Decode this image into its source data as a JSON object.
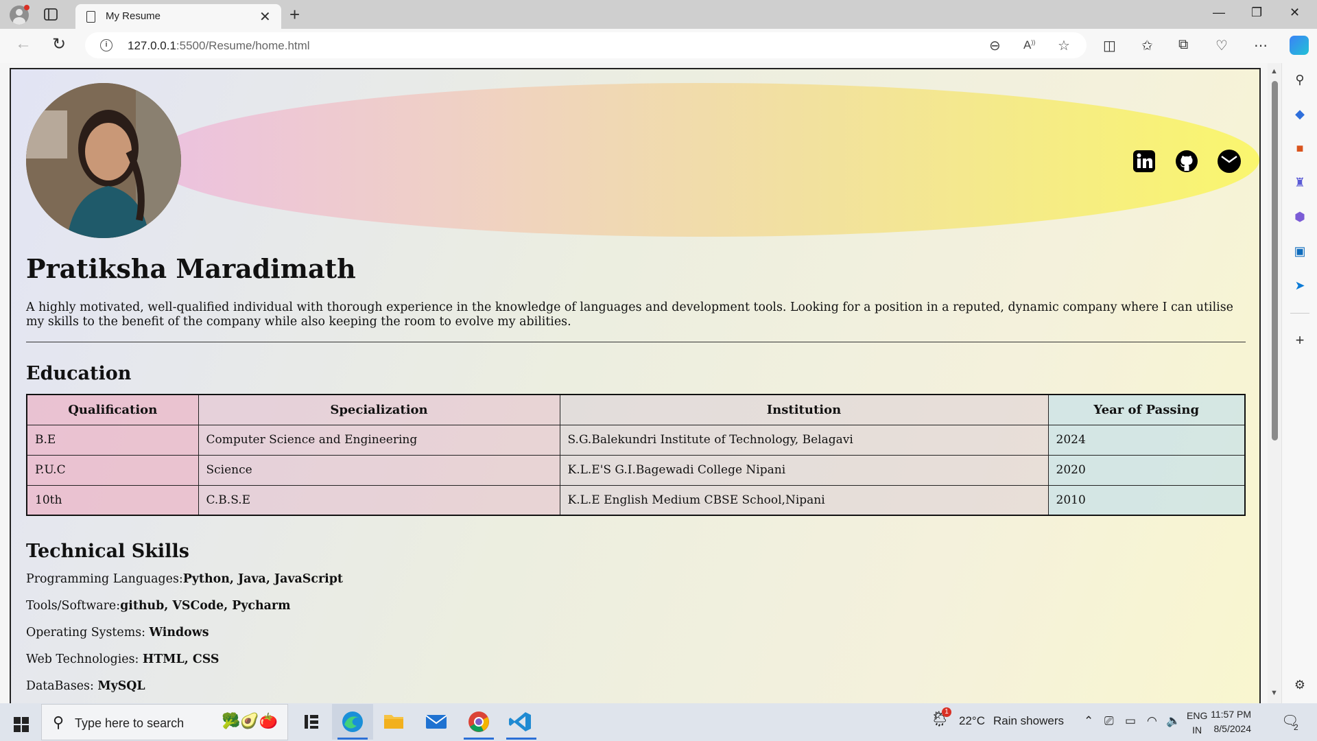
{
  "browser": {
    "tab_title": "My Resume",
    "url_host": "127.0.0.1",
    "url_rest": ":5500/Resume/home.html"
  },
  "resume": {
    "name": "Pratiksha Maradimath",
    "summary": "A highly motivated, well-qualified individual with thorough experience in the knowledge of languages and development tools. Looking for a position in a reputed, dynamic company where I can utilise my skills to the benefit of the company while also keeping the room to evolve my abilities.",
    "education_heading": "Education",
    "education_columns": [
      "Qualification",
      "Specialization",
      "Institution",
      "Year of Passing"
    ],
    "education_rows": [
      [
        "B.E",
        "Computer Science and Engineering",
        "S.G.Balekundri Institute of Technology, Belagavi",
        "2024"
      ],
      [
        "P.U.C",
        "Science",
        "K.L.E'S G.I.Bagewadi College Nipani",
        "2020"
      ],
      [
        "10th",
        "C.B.S.E",
        "K.L.E English Medium CBSE School,Nipani",
        "2010"
      ]
    ],
    "skills_heading": "Technical Skills",
    "skills": [
      {
        "label": "Programming Languages:",
        "value": "Python, Java, JavaScript"
      },
      {
        "label": "Tools/Software:",
        "value": "github, VSCode, Pycharm"
      },
      {
        "label": "Operating Systems: ",
        "value": "Windows"
      },
      {
        "label": "Web Technologies: ",
        "value": "HTML, CSS"
      },
      {
        "label": "DataBases: ",
        "value": "MySQL"
      }
    ],
    "social_icons": [
      "linkedin-icon",
      "github-icon",
      "email-icon"
    ]
  },
  "taskbar": {
    "search_placeholder": "Type here to search",
    "weather_temp": "22°C",
    "weather_text": "Rain showers",
    "weather_badge": "1",
    "lang_top": "ENG",
    "lang_bottom": "IN",
    "time": "11:57 PM",
    "date": "8/5/2024",
    "notifications": "2"
  },
  "colors": {
    "banner_left": "#ecc1e0",
    "banner_right": "#faf66e",
    "page_bg_left": "#e2e4f4",
    "page_bg_right": "#f9f6cf"
  }
}
